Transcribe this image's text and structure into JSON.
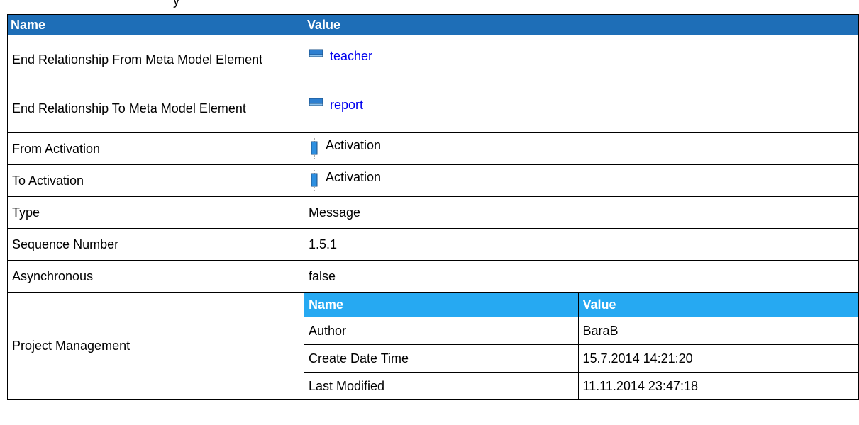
{
  "header": {
    "name_label": "Name",
    "value_label": "Value"
  },
  "rows": [
    {
      "name": "End Relationship From Meta Model Element",
      "value": "teacher",
      "icon": "class-element-icon"
    },
    {
      "name": "End Relationship To Meta Model Element",
      "value": "report",
      "icon": "class-element-icon"
    },
    {
      "name": "From Activation",
      "value": "Activation",
      "icon": "activation-icon"
    },
    {
      "name": "To Activation",
      "value": "Activation",
      "icon": "activation-icon"
    },
    {
      "name": "Type",
      "value": "Message"
    },
    {
      "name": "Sequence Number",
      "value": "1.5.1"
    },
    {
      "name": "Asynchronous",
      "value": "false"
    }
  ],
  "project_management": {
    "label": "Project Management",
    "header": {
      "name_label": "Name",
      "value_label": "Value"
    },
    "rows": [
      {
        "name": "Author",
        "value": "BaraB"
      },
      {
        "name": "Create Date Time",
        "value": "15.7.2014 14:21:20"
      },
      {
        "name": "Last Modified",
        "value": "11.11.2014 23:47:18"
      }
    ]
  },
  "colors": {
    "header_bg": "#1e6eb7",
    "nested_header_bg": "#26a9f2",
    "link": "#0000ee"
  }
}
